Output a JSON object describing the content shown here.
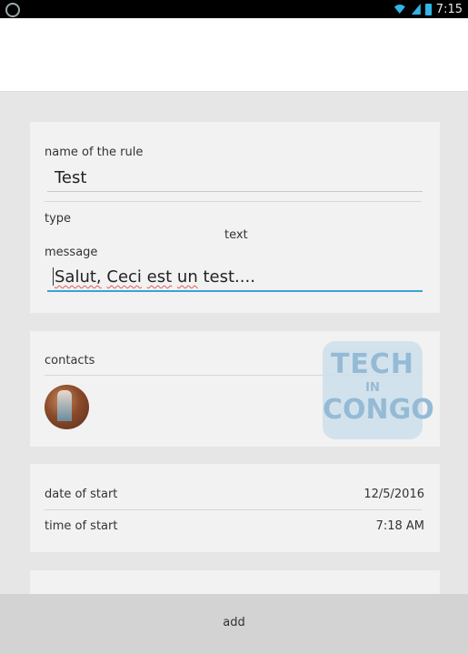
{
  "status_bar": {
    "left_icon": "whatsapp-icon",
    "time": "7:15",
    "icons": [
      "wifi-icon",
      "signal-icon",
      "battery-icon"
    ]
  },
  "rule_card": {
    "name_label": "name of the rule",
    "name_value": "Test",
    "type_label": "type",
    "type_value": "text",
    "message_label": "message",
    "message_words": [
      "Salut,",
      "Ceci",
      "est",
      "un",
      "test...."
    ]
  },
  "contacts_card": {
    "label": "contacts",
    "avatar": "contact-avatar",
    "watermark_lines": [
      "TECH",
      "IN",
      "CONGO"
    ]
  },
  "schedule_card": {
    "date_label": "date of start",
    "date_value": "12/5/2016",
    "time_label": "time of start",
    "time_value": "7:18 AM"
  },
  "footer": {
    "add_label": "add"
  }
}
